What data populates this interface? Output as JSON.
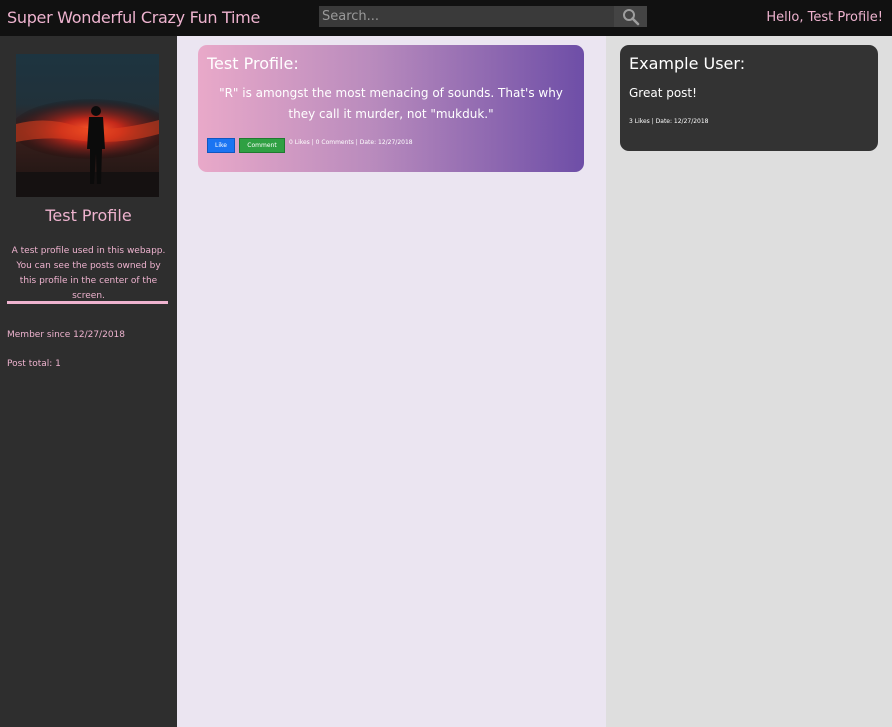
{
  "header": {
    "app_title": "Super Wonderful Crazy Fun Time",
    "search_placeholder": "Search...",
    "search_icon": "magnifier-icon",
    "greeting": "Hello, Test Profile!"
  },
  "sidebar": {
    "avatar_alt": "silhouette-portrait",
    "profile_name": "Test Profile",
    "description": "A test profile used in this webapp. You can see the posts owned by this profile in the center of the screen.",
    "member_since": "Member since 12/27/2018",
    "post_total": "Post total: 1"
  },
  "post": {
    "author": "Test Profile:",
    "body": "\"R\" is amongst the most menacing of sounds. That's why they call it murder, not \"mukduk.\"",
    "like_label": "Like",
    "comment_label": "Comment",
    "meta": "0 Likes | 0 Comments | Date: 12/27/2018"
  },
  "comment": {
    "author": "Example User:",
    "body": "Great post!",
    "meta": "3 Likes | Date: 12/27/2018"
  },
  "colors": {
    "accent_pink": "#eeb3cf",
    "like_blue": "#1a74f2",
    "comment_green": "#2fa043",
    "topbar": "#111111",
    "sidebar": "#2e2e2e",
    "center_bg": "#ebe5f1",
    "right_bg": "#dedede"
  }
}
